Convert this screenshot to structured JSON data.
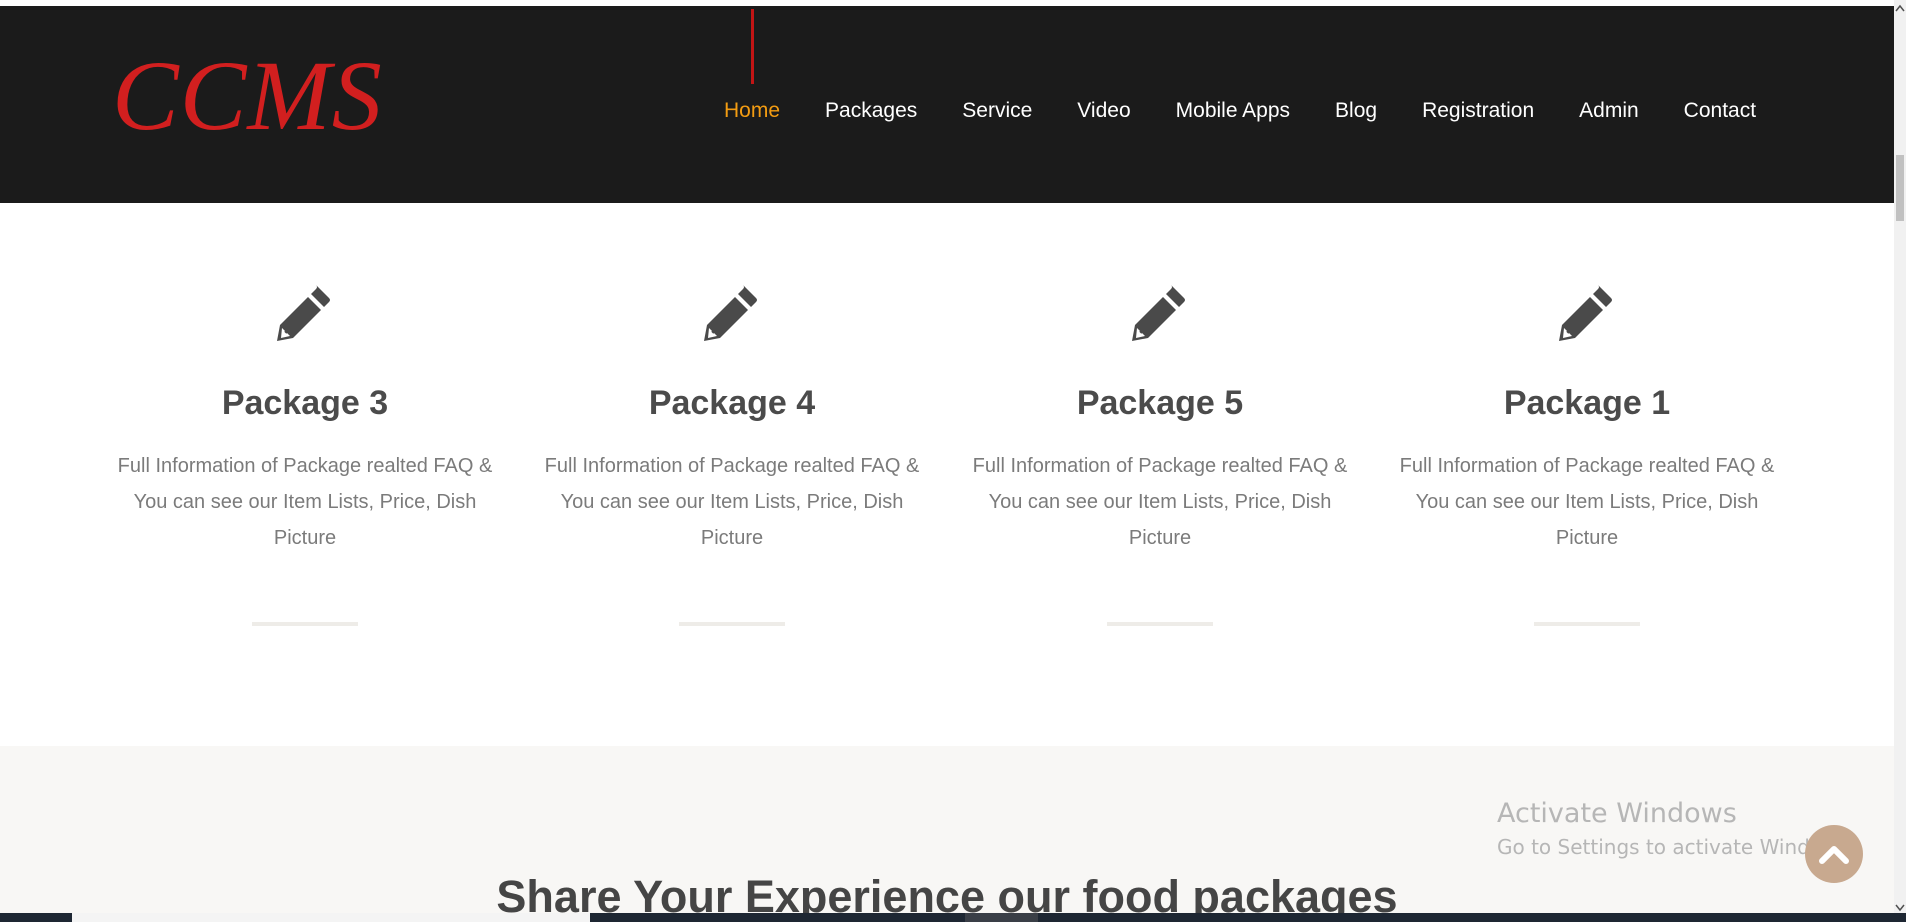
{
  "header": {
    "logo": "CCMS",
    "nav": [
      {
        "label": "Home",
        "active": true
      },
      {
        "label": "Packages"
      },
      {
        "label": "Service"
      },
      {
        "label": "Video"
      },
      {
        "label": "Mobile Apps"
      },
      {
        "label": "Blog"
      },
      {
        "label": "Registration"
      },
      {
        "label": "Admin"
      },
      {
        "label": "Contact"
      }
    ]
  },
  "packages": [
    {
      "icon": "pencil-icon",
      "title": "Package 3",
      "description": "Full Information of Package realted FAQ & You can see our Item Lists, Price, Dish Picture"
    },
    {
      "icon": "pencil-icon",
      "title": "Package 4",
      "description": "Full Information of Package realted FAQ & You can see our Item Lists, Price, Dish Picture"
    },
    {
      "icon": "pencil-icon",
      "title": "Package 5",
      "description": "Full Information of Package realted FAQ & You can see our Item Lists, Price, Dish Picture"
    },
    {
      "icon": "pencil-icon",
      "title": "Package 1",
      "description": "Full Information of Package realted FAQ & You can see our Item Lists, Price, Dish Picture"
    }
  ],
  "share": {
    "title": "Share Your Experience our food packages"
  },
  "watermark": {
    "title": "Activate Windows",
    "subtitle": "Go to Settings to activate Windows."
  },
  "colors": {
    "header_bg": "#1b1b1b",
    "logo": "#d21f1f",
    "nav_active": "#f39c12",
    "nav_text": "#ffffff",
    "icon": "#4a4a4a",
    "scroll_top_button": "#c8a98f"
  }
}
